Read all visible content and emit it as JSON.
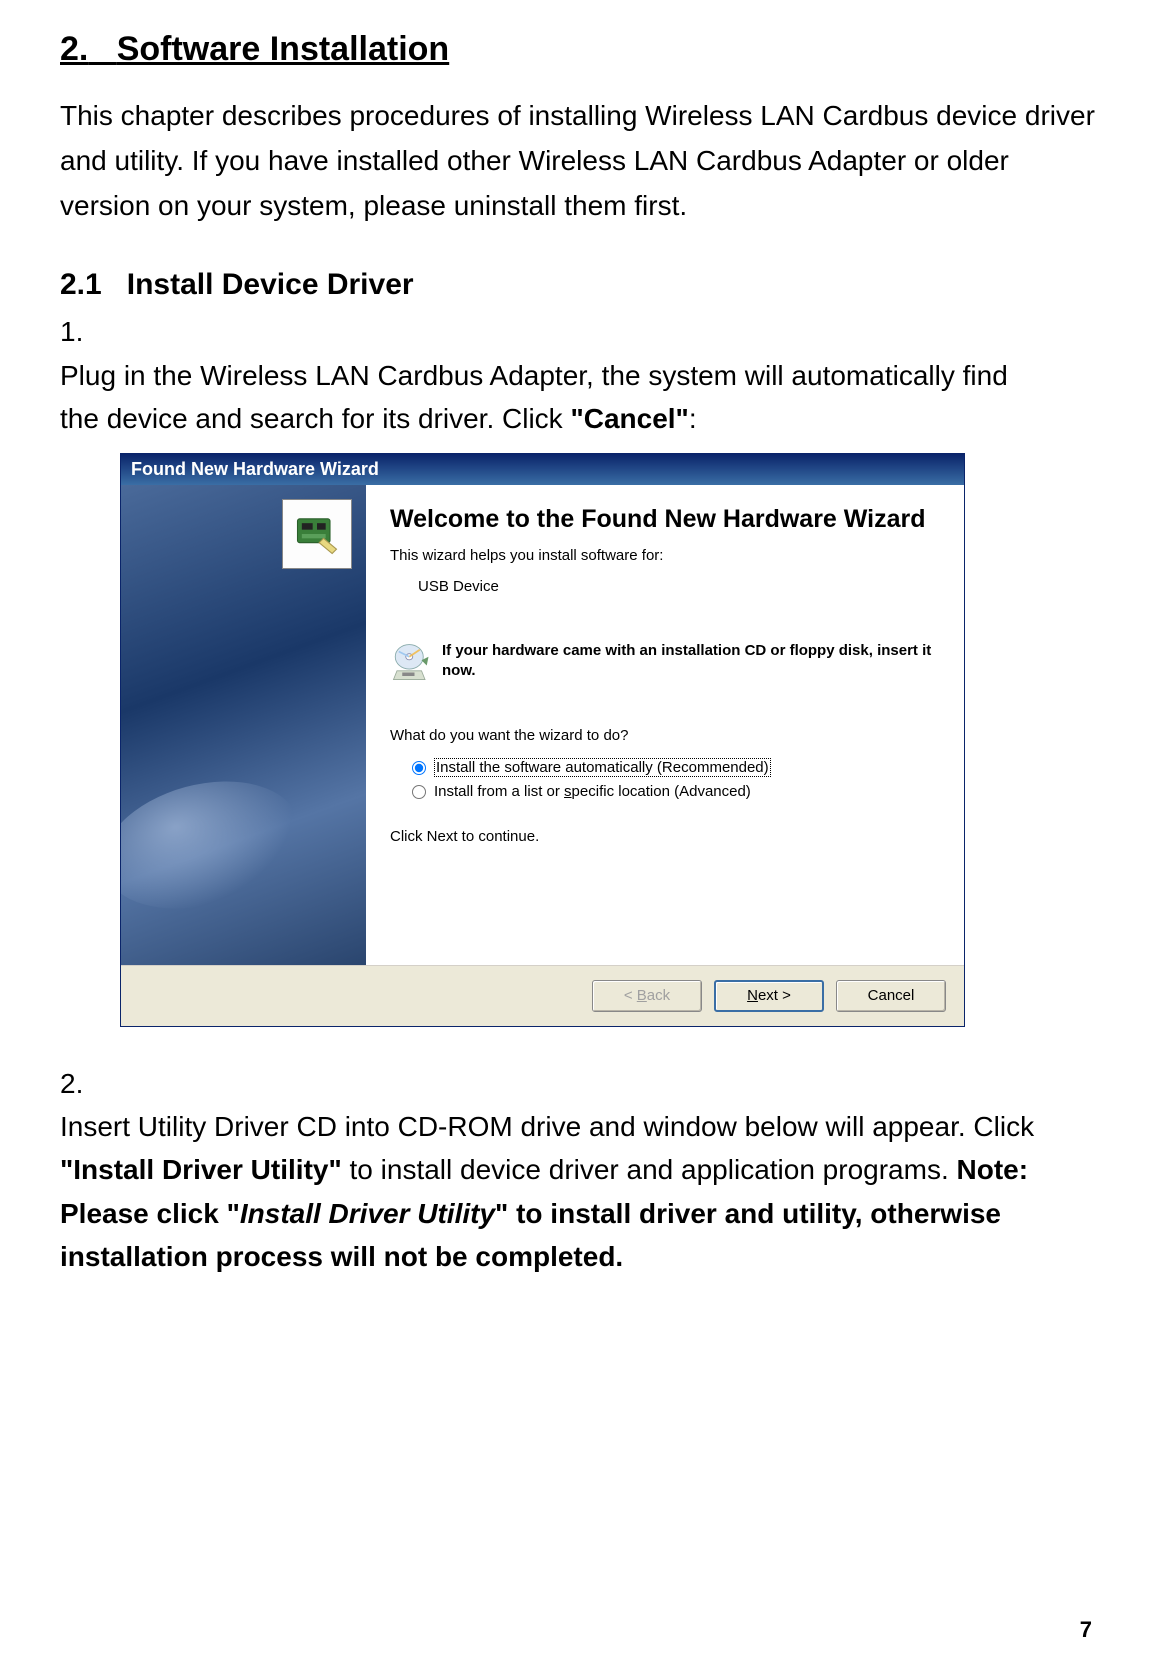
{
  "doc": {
    "section_number": "2.",
    "section_title": "Software Installation",
    "intro_paragraph": "This chapter describes procedures of installing Wireless LAN Cardbus device driver and utility.    If you have installed other Wireless LAN Cardbus Adapter or older version on your system, please uninstall them first.",
    "subsection_number": "2.1",
    "subsection_title": "Install Device Driver",
    "step1_num": "1.",
    "step1_text_a": "Plug in the Wireless LAN Cardbus Adapter, the system will automatically find the device and search for its driver.    Click ",
    "step1_bold": "\"Cancel\"",
    "step1_text_b": ":",
    "step2_num": "2.",
    "step2_text_a": "Insert Utility Driver CD into CD-ROM drive and window below will appear. Click ",
    "step2_bold1": "\"Install Driver Utility\"",
    "step2_text_b": " to install device driver and application programs.    ",
    "step2_bold2_a": "Note: Please click \"",
    "step2_bold2_italic": "Install Driver Utility",
    "step2_bold2_b": "\" to install driver and utility, otherwise installation process will not be completed.",
    "page_number": "7"
  },
  "wizard": {
    "titlebar": "Found New Hardware Wizard",
    "heading": "Welcome to the Found New Hardware Wizard",
    "subtext": "This wizard helps you install software for:",
    "device": "USB Device",
    "cd_notice": "If your hardware came with an installation CD or floppy disk, insert it now.",
    "question": "What do you want the wizard to do?",
    "radio1": "Install the software automatically (Recommended)",
    "radio2_a": "Install from a list or ",
    "radio2_u": "s",
    "radio2_b": "pecific location (Advanced)",
    "continue": "Click Next to continue.",
    "btn_back_lt": "< ",
    "btn_back_u": "B",
    "btn_back_rest": "ack",
    "btn_next_u": "N",
    "btn_next_rest": "ext >",
    "btn_cancel": "Cancel"
  }
}
